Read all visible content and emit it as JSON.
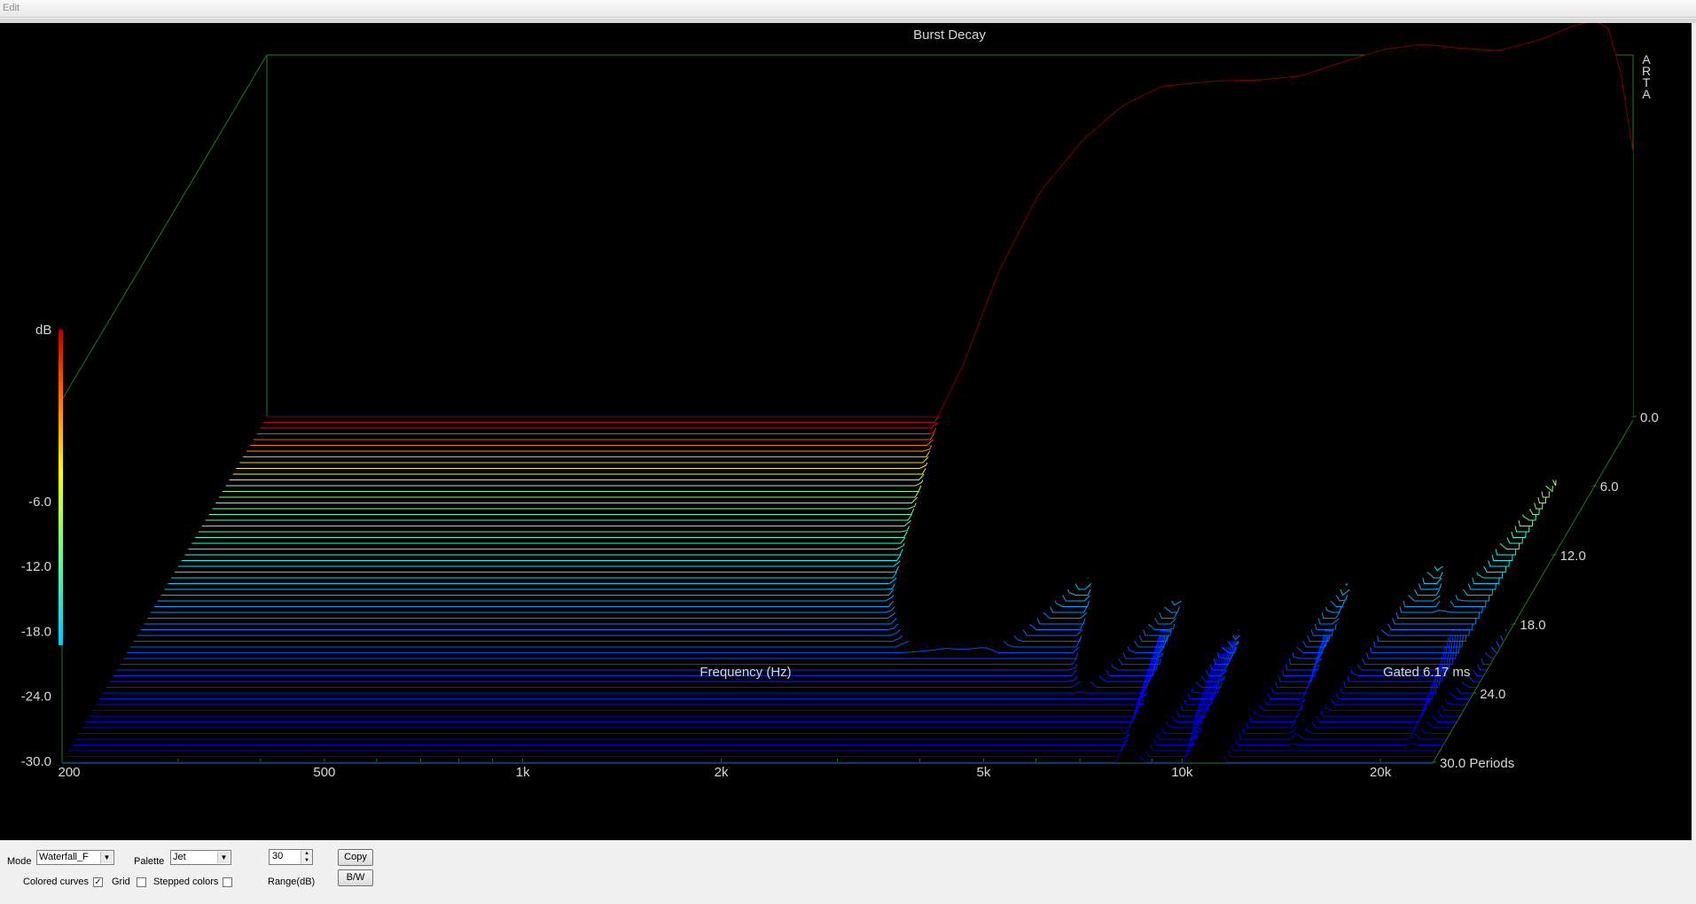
{
  "menu": {
    "edit_label": "Edit"
  },
  "chart_data": {
    "type": "waterfall",
    "title": "Burst Decay",
    "watermark": "ARTA",
    "xlabel": "Frequency (Hz)",
    "x_scale": "log",
    "xlim": [
      200,
      24000
    ],
    "x_ticks_labeled": [
      "200",
      "500",
      "1k",
      "2k",
      "5k",
      "10k",
      "20k"
    ],
    "z_label": "Periods",
    "z_ticks": [
      "0.0",
      "6.0",
      "12.0",
      "18.0",
      "24.0",
      "30.0 Periods"
    ],
    "zlim": [
      0,
      30
    ],
    "ylabel": "dB",
    "ylim": [
      -30,
      0
    ],
    "colorbar_ticks": [
      "-6.0",
      "-12.0",
      "-18.0",
      "-24.0",
      "-30.0"
    ],
    "colormap": "Jet",
    "gating_note": "Gated 6.17 ms",
    "front_curve_db": [
      [
        200,
        -30
      ],
      [
        2100,
        -30
      ],
      [
        2300,
        -26
      ],
      [
        2600,
        -19
      ],
      [
        3000,
        -13
      ],
      [
        3500,
        -9
      ],
      [
        4000,
        -6.5
      ],
      [
        4600,
        -5
      ],
      [
        5500,
        -4.6
      ],
      [
        6500,
        -4.5
      ],
      [
        7500,
        -4.2
      ],
      [
        8500,
        -3.3
      ],
      [
        10000,
        -2.2
      ],
      [
        11500,
        -1.8
      ],
      [
        13000,
        -2.1
      ],
      [
        15000,
        -2.3
      ],
      [
        17500,
        -1.4
      ],
      [
        19500,
        -0.4
      ],
      [
        21000,
        0
      ],
      [
        22000,
        -0.6
      ],
      [
        23000,
        -4
      ],
      [
        24000,
        -10
      ]
    ],
    "decay_dips": [
      {
        "freq": 5000,
        "depth_db": 8
      },
      {
        "freq": 7200,
        "depth_db": 12
      },
      {
        "freq": 9500,
        "depth_db": 16
      },
      {
        "freq": 12500,
        "depth_db": 18
      },
      {
        "freq": 16500,
        "depth_db": 15
      },
      {
        "freq": 20000,
        "depth_db": 9
      },
      {
        "freq": 21500,
        "depth_db": 10
      },
      {
        "freq": 23000,
        "depth_db": 16
      }
    ],
    "colors": {
      "background": "#000000",
      "frame": "#1f7a2a",
      "text": "#d8d8d8",
      "floor_line": "#3a5cff"
    }
  },
  "controls": {
    "mode_label": "Mode",
    "mode_value": "Waterfall_F",
    "palette_label": "Palette",
    "palette_value": "Jet",
    "range_value": "30",
    "range_label": "Range(dB)",
    "copy_label": "Copy",
    "bw_label": "B/W",
    "colored_curves_label": "Colored curves",
    "colored_curves_checked": true,
    "grid_label": "Grid",
    "grid_checked": false,
    "stepped_colors_label": "Stepped colors",
    "stepped_colors_checked": false
  }
}
